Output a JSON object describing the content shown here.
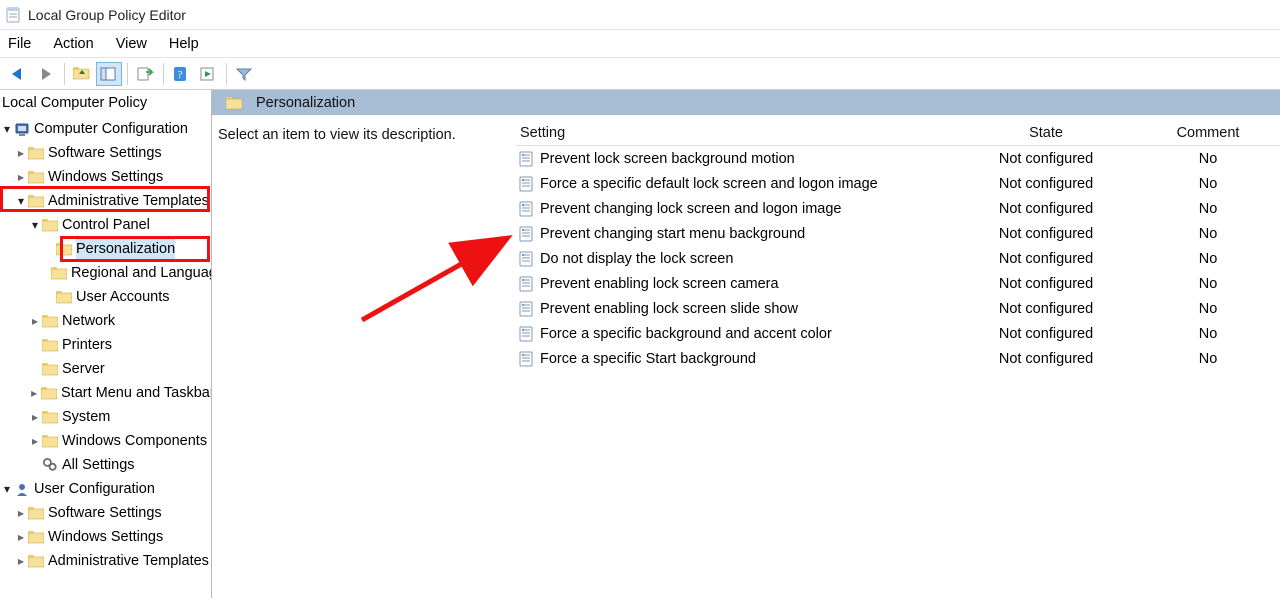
{
  "window": {
    "title": "Local Group Policy Editor"
  },
  "menu": {
    "items": [
      "File",
      "Action",
      "View",
      "Help"
    ]
  },
  "tree": {
    "root_label": "Local Computer Policy",
    "computer_config": {
      "label": "Computer Configuration",
      "children": {
        "software_settings": "Software Settings",
        "windows_settings": "Windows Settings",
        "admin_templates": "Administrative Templates",
        "control_panel": "Control Panel",
        "personalization": "Personalization",
        "regional": "Regional and Language",
        "user_accounts": "User Accounts",
        "network": "Network",
        "printers": "Printers",
        "server": "Server",
        "startmenu": "Start Menu and Taskbar",
        "system": "System",
        "wincomp": "Windows Components",
        "allsettings": "All Settings"
      }
    },
    "user_config": {
      "label": "User Configuration",
      "children": {
        "software_settings": "Software Settings",
        "windows_settings": "Windows Settings",
        "admin_templates": "Administrative Templates"
      }
    }
  },
  "content": {
    "header": "Personalization",
    "description_prompt": "Select an item to view its description.",
    "columns": {
      "setting": "Setting",
      "state": "State",
      "comment": "Comment"
    },
    "rows": [
      {
        "setting": "Prevent lock screen background motion",
        "state": "Not configured",
        "comment": "No"
      },
      {
        "setting": "Force a specific default lock screen and logon image",
        "state": "Not configured",
        "comment": "No"
      },
      {
        "setting": "Prevent changing lock screen and logon image",
        "state": "Not configured",
        "comment": "No"
      },
      {
        "setting": "Prevent changing start menu background",
        "state": "Not configured",
        "comment": "No"
      },
      {
        "setting": "Do not display the lock screen",
        "state": "Not configured",
        "comment": "No"
      },
      {
        "setting": "Prevent enabling lock screen camera",
        "state": "Not configured",
        "comment": "No"
      },
      {
        "setting": "Prevent enabling lock screen slide show",
        "state": "Not configured",
        "comment": "No"
      },
      {
        "setting": "Force a specific background and accent color",
        "state": "Not configured",
        "comment": "No"
      },
      {
        "setting": "Force a specific Start background",
        "state": "Not configured",
        "comment": "No"
      }
    ]
  }
}
